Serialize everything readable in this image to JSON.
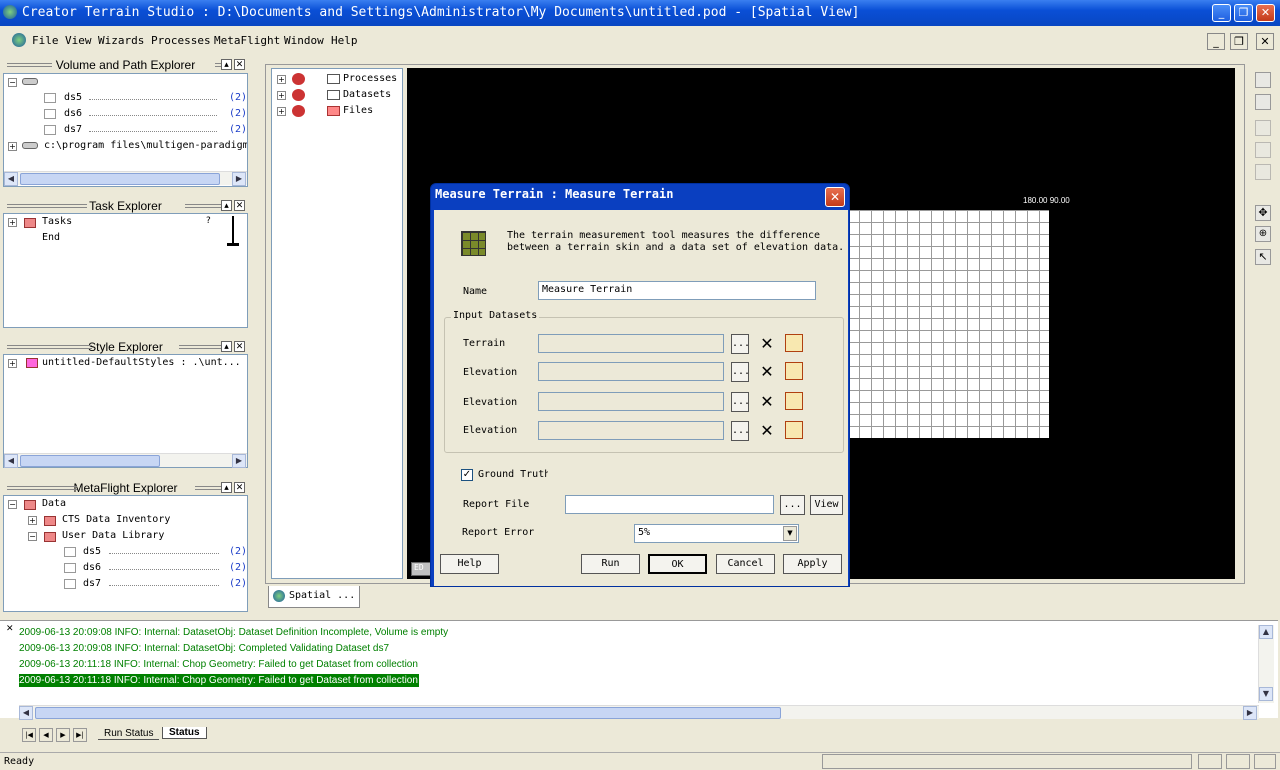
{
  "app": {
    "title": "Creator Terrain Studio : D:\\Documents and Settings\\Administrator\\My Documents\\untitled.pod - [Spatial View]"
  },
  "menu": [
    "File",
    "View",
    "Wizards",
    "Processes",
    "MetaFlight",
    "Window",
    "Help"
  ],
  "volume_explorer": {
    "title": "Volume and Path Explorer",
    "items": [
      {
        "label": "ds5",
        "count": "(2)"
      },
      {
        "label": "ds6",
        "count": "(2)"
      },
      {
        "label": "ds7",
        "count": "(2)"
      }
    ],
    "path": "c:\\program files\\multigen-paradigm"
  },
  "task_explorer": {
    "title": "Task Explorer",
    "items": [
      "Tasks",
      "End"
    ]
  },
  "style_explorer": {
    "title": "Style Explorer",
    "item": "untitled-DefaultStyles : .\\unt..."
  },
  "metaflight_explorer": {
    "title": "MetaFlight Explorer",
    "root": "Data",
    "inventory": "CTS Data Inventory",
    "library": "User Data Library",
    "items": [
      {
        "label": "ds5",
        "count": "(2)"
      },
      {
        "label": "ds6",
        "count": "(2)"
      },
      {
        "label": "ds7",
        "count": "(2)"
      }
    ]
  },
  "spatial_tree": [
    "Processes",
    "Datasets",
    "Files"
  ],
  "coord_label": "180.00 90.00",
  "spatial_tab": "Spatial ...",
  "ed_label": "ED",
  "dialog": {
    "title": "Measure Terrain : Measure Terrain",
    "description": "The terrain measurement tool measures the difference between a terrain skin and a data set of elevation data.",
    "name_label": "Name",
    "name_value": "Measure Terrain",
    "group_label": "Input Datasets",
    "rows": [
      "Terrain",
      "Elevation",
      "Elevation",
      "Elevation"
    ],
    "browse_label": "...",
    "ground_truth_label": "Ground Truth",
    "report_file_label": "Report File",
    "view_label": "View",
    "report_error_label": "Report Error",
    "report_error_value": "5%",
    "buttons": {
      "help": "Help",
      "run": "Run",
      "ok": "OK",
      "cancel": "Cancel",
      "apply": "Apply"
    }
  },
  "log": [
    "2009-06-13 20:09:08 INFO: Internal: DatasetObj: Dataset Definition Incomplete, Volume is empty",
    "2009-06-13 20:09:08 INFO: Internal: DatasetObj: Completed Validating Dataset ds7",
    "2009-06-13 20:11:18 INFO: Internal: Chop Geometry: Failed to get Dataset from collection",
    "2009-06-13 20:11:18 INFO: Internal: Chop Geometry: Failed to get Dataset from collection"
  ],
  "bottom_tabs": {
    "run_status": "Run Status",
    "status": "Status"
  },
  "statusbar": {
    "text": "Ready"
  }
}
